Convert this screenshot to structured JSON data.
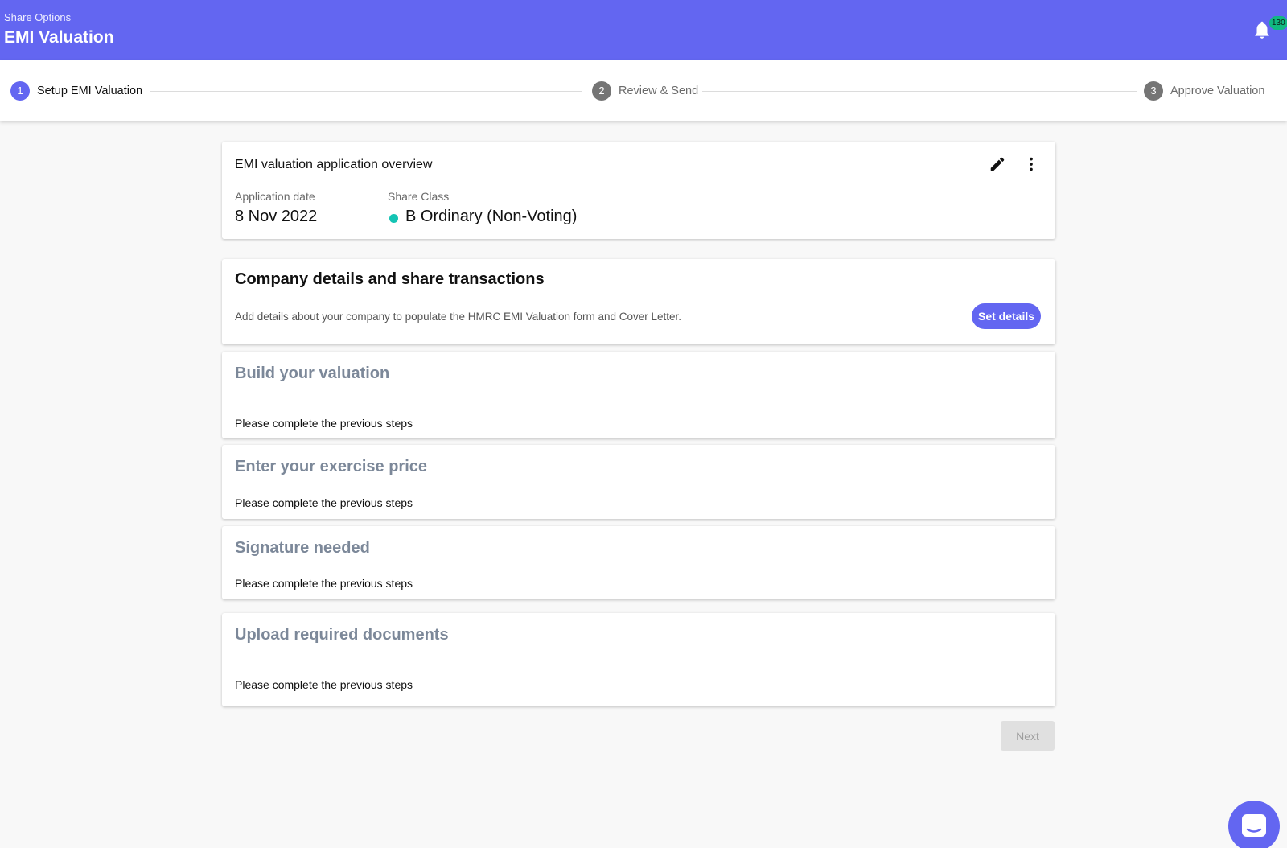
{
  "header": {
    "breadcrumb": "Share Options",
    "title": "EMI Valuation",
    "notification_count": "130"
  },
  "stepper": {
    "steps": [
      {
        "number": "1",
        "label": "Setup EMI Valuation",
        "active": true
      },
      {
        "number": "2",
        "label": "Review & Send",
        "active": false
      },
      {
        "number": "3",
        "label": "Approve Valuation",
        "active": false
      }
    ]
  },
  "overview": {
    "title": "EMI valuation application overview",
    "application_date_label": "Application date",
    "application_date": "8 Nov 2022",
    "share_class_label": "Share Class",
    "share_class": "B Ordinary (Non-Voting)",
    "share_class_color": "#14c4b4"
  },
  "sections": {
    "company": {
      "title": "Company details and share transactions",
      "description": "Add details about your company to populate the HMRC EMI Valuation form and Cover Letter.",
      "button_label": "Set details"
    },
    "build": {
      "title": "Build your valuation",
      "status": "Please complete the previous steps"
    },
    "exercise": {
      "title": "Enter your exercise price",
      "status": "Please complete the previous steps"
    },
    "signature": {
      "title": "Signature needed",
      "status": "Please complete the previous steps"
    },
    "upload": {
      "title": "Upload required documents",
      "status": "Please complete the previous steps"
    }
  },
  "footer": {
    "next_label": "Next"
  },
  "colors": {
    "brand": "#6366f1",
    "badge": "#10b981",
    "disabled_title": "#7c8899"
  }
}
